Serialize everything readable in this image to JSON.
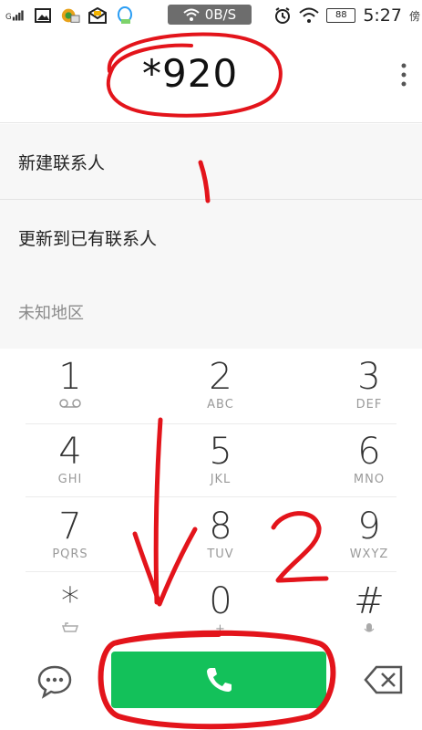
{
  "status_bar": {
    "signal_label": "G",
    "net_speed": "0B/S",
    "battery": "88",
    "time": "5:27",
    "edge_char": "傍",
    "icons": [
      "signal-icon",
      "image-icon",
      "game-icon",
      "mail-icon",
      "qq-icon",
      "wifi-icon",
      "alarm-icon",
      "wifi-icon",
      "battery-icon"
    ]
  },
  "dialer": {
    "dialed_number": "*920",
    "options": [
      "新建联系人",
      "更新到已有联系人",
      "未知地区"
    ],
    "keys": [
      {
        "digit": "1",
        "letters": "⌕"
      },
      {
        "digit": "2",
        "letters": "ABC"
      },
      {
        "digit": "3",
        "letters": "DEF"
      },
      {
        "digit": "4",
        "letters": "GHI"
      },
      {
        "digit": "5",
        "letters": "JKL"
      },
      {
        "digit": "6",
        "letters": "MNO"
      },
      {
        "digit": "7",
        "letters": "PQRS"
      },
      {
        "digit": "8",
        "letters": "TUV"
      },
      {
        "digit": "9",
        "letters": "WXYZ"
      },
      {
        "digit": "*",
        "letters": ""
      },
      {
        "digit": "0",
        "letters": "+"
      },
      {
        "digit": "#",
        "letters": ""
      }
    ]
  },
  "annotations": {
    "label_1": "1",
    "label_2": "2",
    "color": "#e3141b"
  },
  "colors": {
    "call_green": "#13c15a"
  }
}
